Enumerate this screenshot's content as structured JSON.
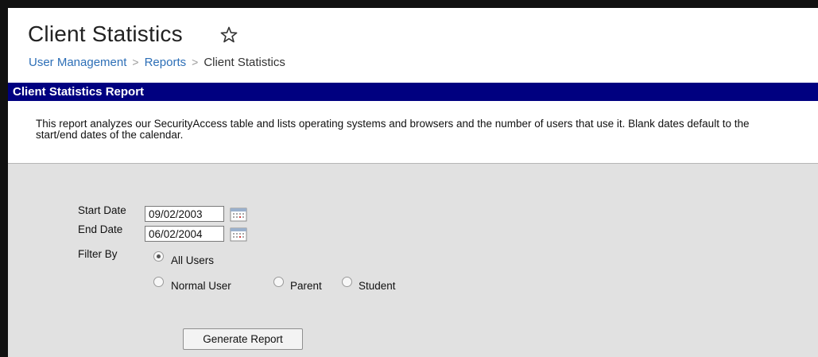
{
  "page": {
    "title": "Client Statistics",
    "favorite_icon": "star-outline-icon"
  },
  "breadcrumb": {
    "items": [
      "User Management",
      "Reports",
      "Client Statistics"
    ],
    "separator": ">"
  },
  "report": {
    "header": "Client Statistics Report",
    "description": "This report analyzes our SecurityAccess table and lists operating systems and browsers and the number of users that use it. Blank dates default to the start/end dates of the calendar."
  },
  "form": {
    "start_date_label": "Start Date",
    "start_date_value": "09/02/2003",
    "end_date_label": "End Date",
    "end_date_value": "06/02/2004",
    "calendar_icon": "calendar-icon",
    "filter_label": "Filter By",
    "filter_options": [
      {
        "label": "All Users",
        "selected": true
      },
      {
        "label": "Normal User",
        "selected": false
      },
      {
        "label": "Parent",
        "selected": false
      },
      {
        "label": "Student",
        "selected": false
      }
    ],
    "generate_button": "Generate Report"
  },
  "colors": {
    "header_bar": "#000080",
    "link": "#2d6fb7",
    "form_background": "#e1e1e1"
  }
}
